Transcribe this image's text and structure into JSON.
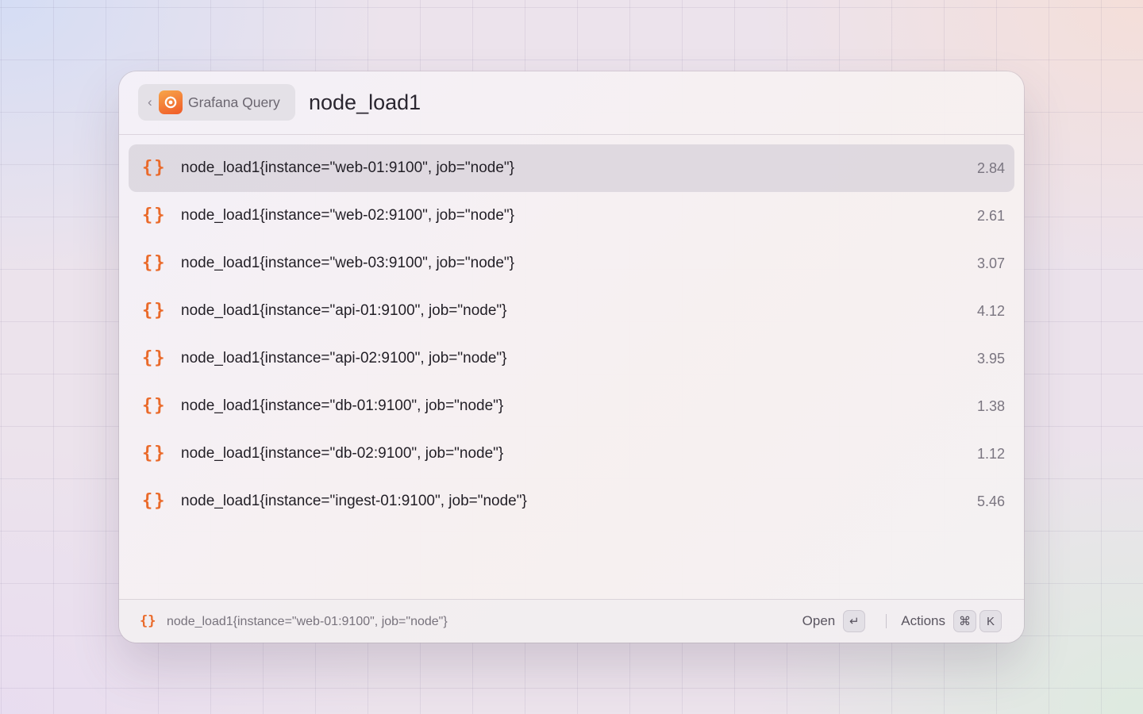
{
  "header": {
    "back_chevron": "‹",
    "extension_name": "Grafana Query",
    "query": "node_load1"
  },
  "results": [
    {
      "title": "node_load1{instance=\"web-01:9100\", job=\"node\"}",
      "value": "2.84",
      "icon": "{}"
    },
    {
      "title": "node_load1{instance=\"web-02:9100\", job=\"node\"}",
      "value": "2.61",
      "icon": "{}"
    },
    {
      "title": "node_load1{instance=\"web-03:9100\", job=\"node\"}",
      "value": "3.07",
      "icon": "{}"
    },
    {
      "title": "node_load1{instance=\"api-01:9100\", job=\"node\"}",
      "value": "4.12",
      "icon": "{}"
    },
    {
      "title": "node_load1{instance=\"api-02:9100\", job=\"node\"}",
      "value": "3.95",
      "icon": "{}"
    },
    {
      "title": "node_load1{instance=\"db-01:9100\", job=\"node\"}",
      "value": "1.38",
      "icon": "{}"
    },
    {
      "title": "node_load1{instance=\"db-02:9100\", job=\"node\"}",
      "value": "1.12",
      "icon": "{}"
    },
    {
      "title": "node_load1{instance=\"ingest-01:9100\", job=\"node\"}",
      "value": "5.46",
      "icon": "{}"
    }
  ],
  "footer": {
    "icon": "{}",
    "selected_title": "node_load1{instance=\"web-01:9100\", job=\"node\"}",
    "open_label": "Open",
    "open_key": "↵",
    "actions_label": "Actions",
    "actions_key_mod": "⌘",
    "actions_key": "K"
  },
  "colors": {
    "accent": "#ea6a2a",
    "selected_row": "#dcd7dd"
  }
}
